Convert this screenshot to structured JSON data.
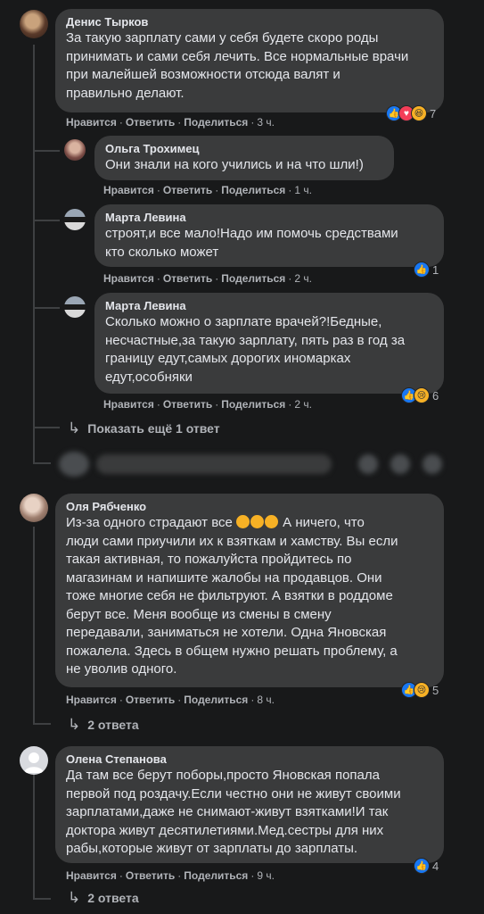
{
  "comments": [
    {
      "author": "Денис Тырков",
      "text": "За такую зарплату сами у себя будете скоро роды\nпринимать и сами себя лечить. Все нормальные врачи\nпри малейшей возможности отсюда валят и\nправильно делают.",
      "time": "3 ч.",
      "reactions": {
        "icons": [
          "like-icon",
          "love-icon",
          "haha-icon"
        ],
        "count": "7"
      },
      "replies": [
        {
          "author": "Ольга Трохимец",
          "text": "Они знали на кого учились и на что шли!)",
          "time": "1 ч."
        },
        {
          "author": "Марта Левина",
          "text": "строят,и все мало!Надо им помочь средствами\nкто сколько может",
          "time": "2 ч.",
          "reactions": {
            "icons": [
              "like-icon"
            ],
            "count": "1"
          }
        },
        {
          "author": "Марта Левина",
          "text": "Сколько можно о зарплате врачей?!Бедные,\nнесчастные,за такую зарплату, пять раз в год за\nграницу едут,самых дорогих иномарках\nедут,особняки",
          "time": "2 ч.",
          "reactions": {
            "icons": [
              "like-icon",
              "sad-icon"
            ],
            "count": "6"
          }
        }
      ],
      "show_more": "Показать ещё 1 ответ"
    },
    {
      "author": "Оля Рябченко",
      "text_before_emoji": "Из-за одного страдают все",
      "text_after_emoji": " А ничего, что",
      "text_rest": "люди сами приучили их к взяткам и хамству. Вы если\nтакая активная, то пожалуйста пройдитесь по\nмагазинам и напишите жалобы на продавцов. Они\nтоже многие себя не фильтруют. А взятки в роддоме\nберут все. Меня вообще из смены в смену\nпередавали, заниматься не хотели. Одна Яновская\nпожалела. Здесь в общем нужно решать проблему, а\nне уволив одного.",
      "time": "8 ч.",
      "reactions": {
        "icons": [
          "like-icon",
          "sad-icon"
        ],
        "count": "5"
      },
      "replies_link": "2 ответа"
    },
    {
      "author": "Олена Степанова",
      "text": "Да там все берут поборы,просто Яновская попала\nпервой под роздачу.Если честно они не живут своими\nзарплатами,даже не снимают-живут взятками!И так\nдоктора живут десятилетиями.Мед.сестры для них\nрабы,которые живут от зарплаты до зарплаты.",
      "time": "9 ч.",
      "reactions": {
        "icons": [
          "like-icon"
        ],
        "count": "4"
      },
      "replies_link": "2 ответа"
    }
  ],
  "actions": {
    "like": "Нравится",
    "reply": "Ответить",
    "share": "Поделиться"
  },
  "colors": {
    "background": "#18191a",
    "bubble": "#3a3b3c",
    "text": "#e4e6eb",
    "muted": "#b0b3b8",
    "like": "#1877f2"
  }
}
